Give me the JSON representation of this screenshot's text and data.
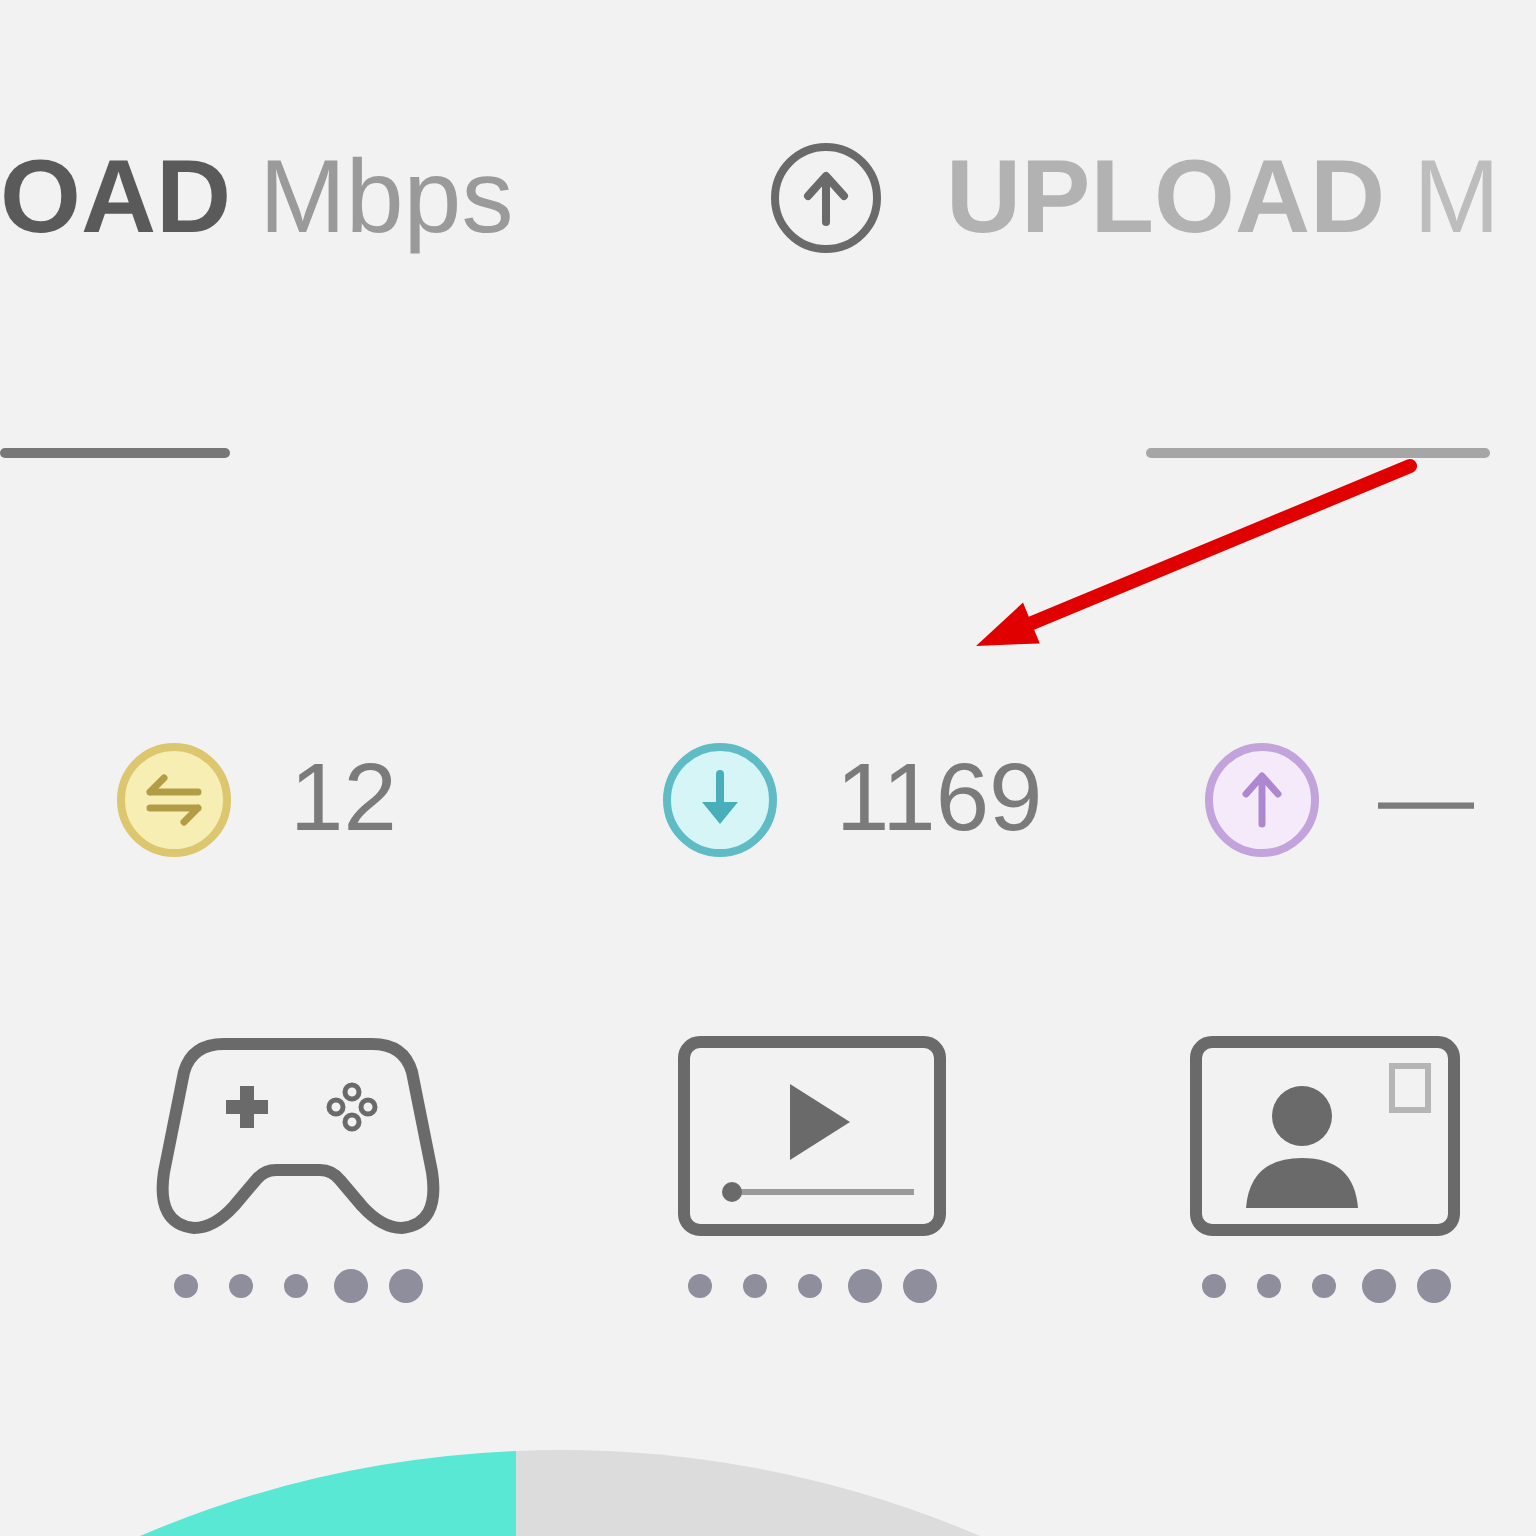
{
  "header": {
    "metrics": [
      {
        "kind": "download",
        "label": "OAD",
        "unit": "Mbps",
        "active": true
      },
      {
        "kind": "upload",
        "label": "UPLOAD",
        "unit": "M",
        "active": false
      }
    ]
  },
  "stats": [
    {
      "kind": "ping",
      "value": "12"
    },
    {
      "kind": "download",
      "value": "1169"
    },
    {
      "kind": "upload",
      "value": "—"
    }
  ],
  "activities": [
    {
      "kind": "gaming",
      "dots": [
        {
          "kind": "small"
        },
        {
          "kind": "small"
        },
        {
          "kind": "small"
        },
        {
          "kind": "large"
        },
        {
          "kind": "large"
        }
      ]
    },
    {
      "kind": "streaming",
      "dots": [
        {
          "kind": "small"
        },
        {
          "kind": "small"
        },
        {
          "kind": "small"
        },
        {
          "kind": "large"
        },
        {
          "kind": "large"
        }
      ]
    },
    {
      "kind": "video_chat",
      "dots": [
        {
          "kind": "small"
        },
        {
          "kind": "small"
        },
        {
          "kind": "small"
        },
        {
          "kind": "large"
        },
        {
          "kind": "large"
        }
      ]
    }
  ],
  "annotations": [
    {
      "kind": "arrow"
    }
  ]
}
